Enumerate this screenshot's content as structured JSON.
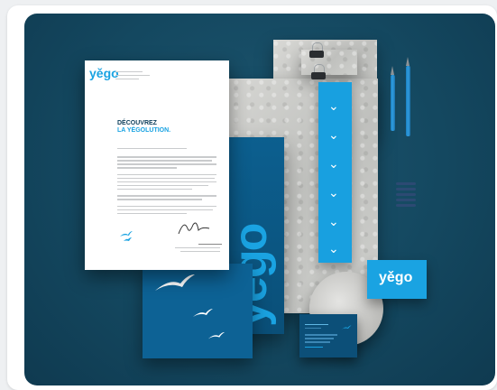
{
  "letter": {
    "logo": "yěgo",
    "heading_line1": "DÉCOUVREZ",
    "heading_line2": "LA YÉGOLUTION."
  },
  "folder": {
    "logo": "yěgo"
  },
  "business_card": {
    "logo": "yěgo"
  },
  "colors": {
    "brand_blue": "#1aa3e2",
    "dark_blue": "#0c4f78",
    "background": "#144860"
  }
}
